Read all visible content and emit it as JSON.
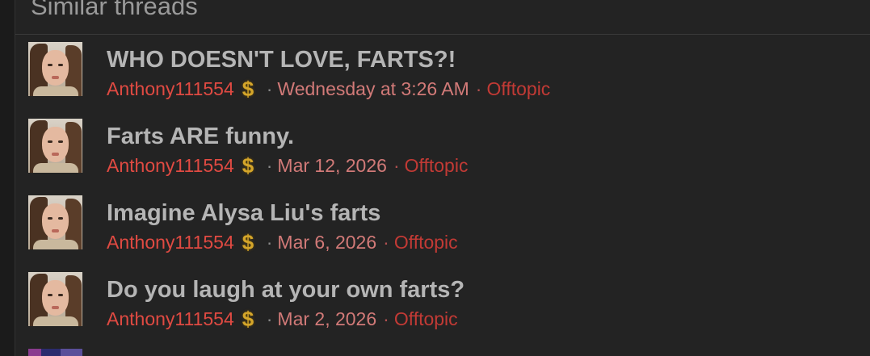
{
  "section": {
    "header": "Similar threads"
  },
  "threads": [
    {
      "title": "WHO DOESN'T LOVE, FARTS?!",
      "author": "Anthony111554",
      "badge_symbol": "$",
      "separator": "·",
      "date": "Wednesday at 3:26 AM",
      "forum_separator": "·",
      "forum": "Offtopic"
    },
    {
      "title": "Farts ARE funny.",
      "author": "Anthony111554",
      "badge_symbol": "$",
      "separator": "·",
      "date": "Mar 12, 2026",
      "forum_separator": "·",
      "forum": "Offtopic"
    },
    {
      "title": "Imagine Alysa Liu's farts",
      "author": "Anthony111554",
      "badge_symbol": "$",
      "separator": "·",
      "date": "Mar 6, 2026",
      "forum_separator": "·",
      "forum": "Offtopic"
    },
    {
      "title": "Do you laugh at your own farts?",
      "author": "Anthony111554",
      "badge_symbol": "$",
      "separator": "·",
      "date": "Mar 2, 2026",
      "forum_separator": "·",
      "forum": "Offtopic"
    }
  ],
  "colors": {
    "background": "#232323",
    "title": "#b5b5b5",
    "author": "#e04a42",
    "date": "#d27a78",
    "forum": "#c23a35",
    "badge": "#d4a52a"
  }
}
